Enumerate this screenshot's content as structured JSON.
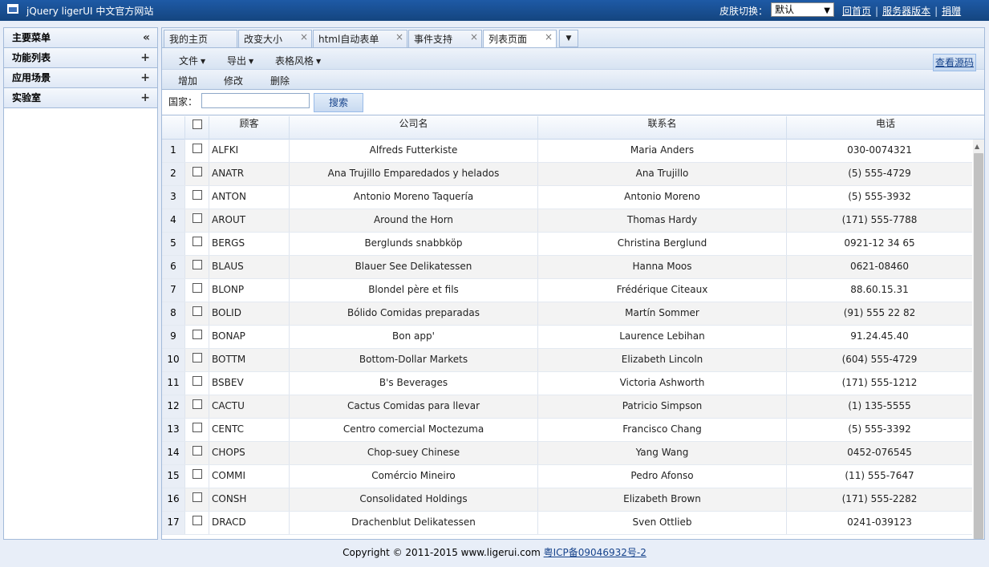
{
  "topbar": {
    "site_title": "jQuery ligerUI 中文官方网站",
    "skin_label": "皮肤切换：",
    "skin_value": "默认",
    "links": [
      "回首页",
      "服务器版本",
      "捐赠"
    ]
  },
  "sidebar": {
    "items": [
      {
        "label": "主要菜单",
        "toggle": "«"
      },
      {
        "label": "功能列表",
        "toggle": "+"
      },
      {
        "label": "应用场景",
        "toggle": "+"
      },
      {
        "label": "实验室",
        "toggle": "+"
      }
    ]
  },
  "tabs": [
    {
      "label": "我的主页",
      "closable": false
    },
    {
      "label": "改变大小",
      "closable": true
    },
    {
      "label": "html自动表单",
      "closable": true
    },
    {
      "label": "事件支持",
      "closable": true
    },
    {
      "label": "列表页面",
      "closable": true,
      "active": true
    }
  ],
  "menu": {
    "file": "文件",
    "export": "导出",
    "grid_style": "表格风格",
    "view_source": "查看源码"
  },
  "toolbar": {
    "add": "增加",
    "edit": "修改",
    "delete": "删除"
  },
  "search": {
    "label": "国家：",
    "value": "",
    "button": "搜索"
  },
  "grid": {
    "columns": [
      "顾客",
      "公司名",
      "联系名",
      "电话"
    ],
    "rows": [
      {
        "n": "1",
        "cust": "ALFKI",
        "comp": "Alfreds Futterkiste",
        "cont": "Maria Anders",
        "phone": "030-0074321"
      },
      {
        "n": "2",
        "cust": "ANATR",
        "comp": "Ana Trujillo Emparedados y helados",
        "cont": "Ana Trujillo",
        "phone": "(5) 555-4729"
      },
      {
        "n": "3",
        "cust": "ANTON",
        "comp": "Antonio Moreno Taquería",
        "cont": "Antonio Moreno",
        "phone": "(5) 555-3932"
      },
      {
        "n": "4",
        "cust": "AROUT",
        "comp": "Around the Horn",
        "cont": "Thomas Hardy",
        "phone": "(171) 555-7788"
      },
      {
        "n": "5",
        "cust": "BERGS",
        "comp": "Berglunds snabbköp",
        "cont": "Christina Berglund",
        "phone": "0921-12 34 65"
      },
      {
        "n": "6",
        "cust": "BLAUS",
        "comp": "Blauer See Delikatessen",
        "cont": "Hanna Moos",
        "phone": "0621-08460"
      },
      {
        "n": "7",
        "cust": "BLONP",
        "comp": "Blondel père et fils",
        "cont": "Frédérique Citeaux",
        "phone": "88.60.15.31"
      },
      {
        "n": "8",
        "cust": "BOLID",
        "comp": "Bólido Comidas preparadas",
        "cont": "Martín Sommer",
        "phone": "(91) 555 22 82"
      },
      {
        "n": "9",
        "cust": "BONAP",
        "comp": "Bon app'",
        "cont": "Laurence Lebihan",
        "phone": "91.24.45.40"
      },
      {
        "n": "10",
        "cust": "BOTTM",
        "comp": "Bottom-Dollar Markets",
        "cont": "Elizabeth Lincoln",
        "phone": "(604) 555-4729"
      },
      {
        "n": "11",
        "cust": "BSBEV",
        "comp": "B's Beverages",
        "cont": "Victoria Ashworth",
        "phone": "(171) 555-1212"
      },
      {
        "n": "12",
        "cust": "CACTU",
        "comp": "Cactus Comidas para llevar",
        "cont": "Patricio Simpson",
        "phone": "(1) 135-5555"
      },
      {
        "n": "13",
        "cust": "CENTC",
        "comp": "Centro comercial Moctezuma",
        "cont": "Francisco Chang",
        "phone": "(5) 555-3392"
      },
      {
        "n": "14",
        "cust": "CHOPS",
        "comp": "Chop-suey Chinese",
        "cont": "Yang Wang",
        "phone": "0452-076545"
      },
      {
        "n": "15",
        "cust": "COMMI",
        "comp": "Comércio Mineiro",
        "cont": "Pedro Afonso",
        "phone": "(11) 555-7647"
      },
      {
        "n": "16",
        "cust": "CONSH",
        "comp": "Consolidated Holdings",
        "cont": "Elizabeth Brown",
        "phone": "(171) 555-2282"
      },
      {
        "n": "17",
        "cust": "DRACD",
        "comp": "Drachenblut Delikatessen",
        "cont": "Sven Ottlieb",
        "phone": "0241-039123"
      }
    ]
  },
  "footer": {
    "copyright": "Copyright © 2011-2015 www.ligerui.com",
    "icp": "粤ICP备09046932号-2"
  }
}
